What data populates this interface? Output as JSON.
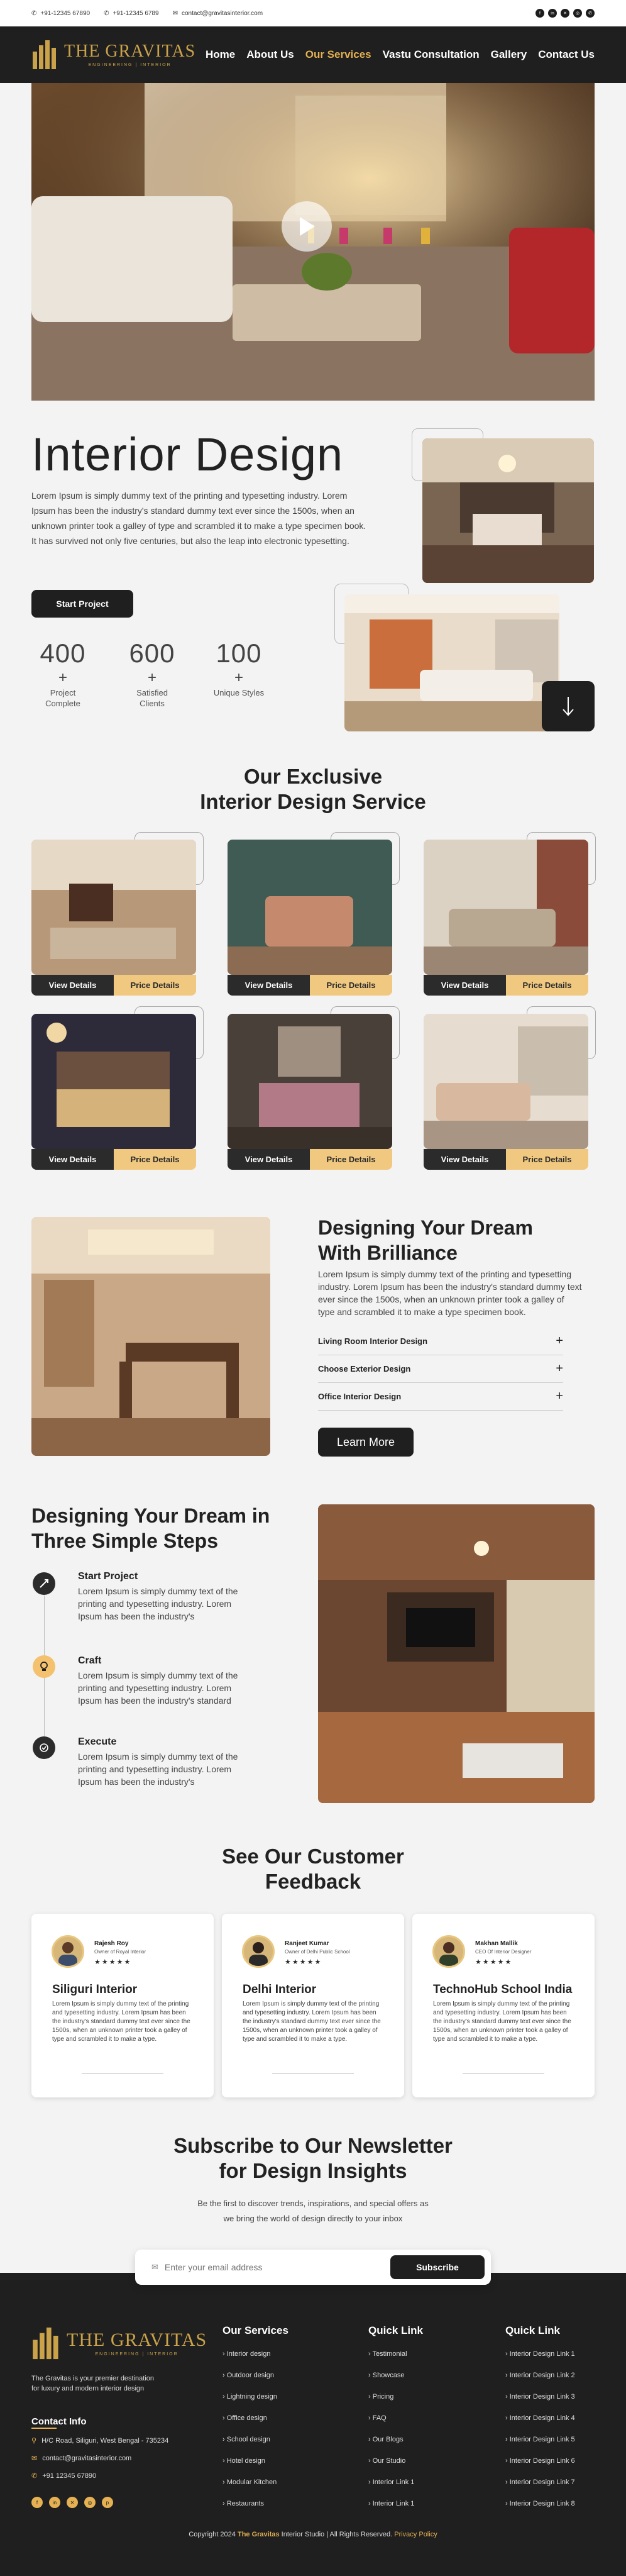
{
  "topbar": {
    "phone1": "+91-12345 67890",
    "phone2": "+91-12345 6789",
    "email": "contact@gravitasinterior.com",
    "social_icons": [
      "facebook-icon",
      "linkedin-icon",
      "x-icon",
      "instagram-icon",
      "whatsapp-icon"
    ]
  },
  "header": {
    "logo_name": "THE GRAVITAS",
    "logo_sub": "ENGINEERING | INTERIOR",
    "nav": [
      {
        "label": "Home",
        "active": false
      },
      {
        "label": "About Us",
        "active": false
      },
      {
        "label": "Our Services",
        "active": true
      },
      {
        "label": "Vastu Consultation",
        "active": false
      },
      {
        "label": "Gallery",
        "active": false
      },
      {
        "label": "Contact Us",
        "active": false
      }
    ]
  },
  "intro": {
    "title": "Interior Design",
    "text": "Lorem Ipsum is simply dummy text of the printing and typesetting industry. Lorem Ipsum has been the industry's standard dummy text ever since the 1500s, when an unknown printer took a galley of type and scrambled it to make a type specimen book. It has survived not only five centuries, but also the leap into electronic typesetting.",
    "button": "Start Project",
    "stats": [
      {
        "num": "400",
        "plus": "+",
        "label": "Project Complete"
      },
      {
        "num": "600",
        "plus": "+",
        "label": "Satisfied Clients"
      },
      {
        "num": "100",
        "plus": "+",
        "label": "Unique Styles"
      }
    ]
  },
  "services": {
    "title_line1": "Our Exclusive",
    "title_line2": "Interior Design Service",
    "view_label": "View Details",
    "price_label": "Price Details"
  },
  "dream": {
    "title_line1": "Designing Your Dream",
    "title_line2": "With Brilliance",
    "text": "Lorem Ipsum is simply dummy text of the printing and typesetting industry. Lorem Ipsum has been the industry's standard dummy text ever since the 1500s, when an unknown printer took a galley of type and scrambled it to make a type specimen book.",
    "accordion": [
      "Living Room Interior Design",
      "Choose Exterior Design",
      "Office Interior Design"
    ],
    "button": "Learn More"
  },
  "steps": {
    "title_line1": "Designing Your Dream in",
    "title_line2": "Three Simple Steps",
    "items": [
      {
        "title": "Start Project",
        "text": "Lorem Ipsum is simply dummy text of the printing and typesetting industry. Lorem Ipsum has been the industry's"
      },
      {
        "title": "Craft",
        "text": "Lorem Ipsum is simply dummy text of the printing and typesetting industry. Lorem Ipsum has been the industry's standard"
      },
      {
        "title": "Execute",
        "text": "Lorem Ipsum is simply dummy text of the printing and typesetting industry. Lorem Ipsum has been the industry's"
      }
    ]
  },
  "feedback": {
    "title_line1": "See Our Customer",
    "title_line2": "Feedback",
    "cards": [
      {
        "name": "Rajesh Roy",
        "role": "Owner of Royal Interior",
        "stars": "★★★★★",
        "heading": "Siliguri Interior",
        "text": "Lorem Ipsum is simply dummy text of the printing and typesetting industry. Lorem Ipsum has been the industry's standard dummy text ever since the 1500s, when an unknown printer took a galley of type and scrambled it to make a type."
      },
      {
        "name": "Ranjeet Kumar",
        "role": "Owner of Delhi Public School",
        "stars": "★★★★★",
        "heading": "Delhi Interior",
        "text": "Lorem Ipsum is simply dummy text of the printing and typesetting industry. Lorem Ipsum has been the industry's standard dummy text ever since the 1500s, when an unknown printer took a galley of type and scrambled it to make a type."
      },
      {
        "name": "Makhan Mallik",
        "role": "CEO Of Interior Designer",
        "stars": "★★★★★",
        "heading": "TechnoHub School India",
        "text": "Lorem Ipsum is simply dummy text of the printing and typesetting industry. Lorem Ipsum has been the industry's standard dummy text ever since the 1500s, when an unknown printer took a galley of type and scrambled it to make a type."
      }
    ]
  },
  "newsletter": {
    "title_line1": "Subscribe to Our Newsletter",
    "title_line2": "for Design Insights",
    "text_line1": "Be the first to discover trends, inspirations, and special offers as",
    "text_line2": "we bring the world of design directly to your inbox",
    "placeholder": "Enter your email address",
    "button": "Subscribe"
  },
  "footer": {
    "logo_name": "THE GRAVITAS",
    "logo_sub": "ENGINEERING | INTERIOR",
    "about": "The Gravitas is your premier destination for luxury and modern interior design",
    "contact_title": "Contact Info",
    "address": "H/C Road, Siliguri, West Bengal - 735234",
    "email": "contact@gravitasinterior.com",
    "phone": "+91 12345 67890",
    "col1_title": "Our Services",
    "col1": [
      "Interior design",
      "Outdoor design",
      "Lightning design",
      "Office design",
      "School design",
      "Hotel design",
      "Modular Kitchen",
      "Restaurants"
    ],
    "col2_title": "Quick Link",
    "col2": [
      "Testimonial",
      "Showcase",
      "Pricing",
      "FAQ",
      "Our Blogs",
      "Our Studio",
      "Interior Link 1",
      "Interior Link 1"
    ],
    "col3_title": "Quick Link",
    "col3": [
      "Interior Design Link 1",
      "Interior Design Link 2",
      "Interior Design Link 3",
      "Interior Design Link 4",
      "Interior Design Link 5",
      "Interior Design Link 6",
      "Interior Design Link 7",
      "Interior Design Link 8"
    ],
    "copyright_pre": "Copyright 2024",
    "copyright_brand": "The Gravitas",
    "copyright_mid": "Interior Studio | All Rights Reserved.",
    "privacy": "Privacy Policy"
  },
  "colors": {
    "accent": "#e5b153",
    "dark": "#1f1f1f",
    "price_tab": "#f0c880"
  }
}
